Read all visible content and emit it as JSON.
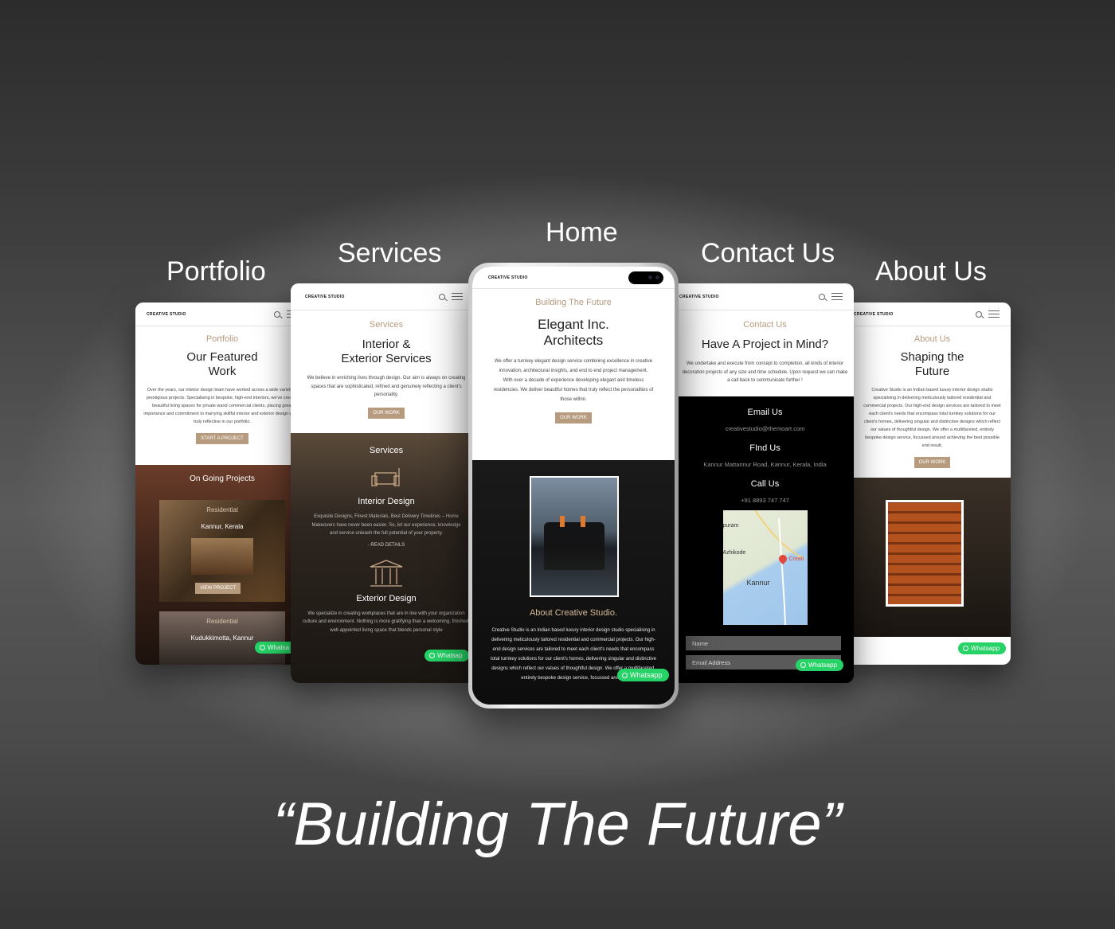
{
  "brand": "CREATIVE STUDIO",
  "tagline": "“Building The Future”",
  "labels": {
    "portfolio": "Portfolio",
    "services": "Services",
    "home": "Home",
    "contact": "Contact Us",
    "about": "About Us"
  },
  "whatsapp_label": "Whatsapp",
  "whatsapp_label_cut": "Whatsa",
  "whatsapp_label_cut2": "Whatsap",
  "colors": {
    "accent": "#b69b7f",
    "whatsapp": "#25d366",
    "dark": "#111111"
  },
  "portfolio": {
    "eyebrow": "Portfolio",
    "heading_1": "Our Featured",
    "heading_2": "Work",
    "body": "Over the years, our interior design team have worked across a wide variety of prestigious projects. Specialising in bespoke, high-end interiors, we've created beautiful living spaces for private wand commercial clients, placing great importance and commitment to marrying skillful interior and exterior design which truly reflective in our portfolio.",
    "button": "START A PROJECT",
    "ongoing_title": "On Going Projects",
    "tag_1": "Residential",
    "location_1": "Kannur, Kerala",
    "view_button": "VIEW PROJECT",
    "tag_2": "Residential",
    "location_2": "Kudukkimotta, Kannur"
  },
  "services": {
    "eyebrow": "Services",
    "heading_1": "Interior &",
    "heading_2": "Exterior Services",
    "body": "We believe in enriching lives through design. Our aim is always on creating spaces that are sophisticated, refined and genuinely reflecting a client's personality.",
    "button": "OUR WORK",
    "dark_title": "Services",
    "interior_title": "Interior Design",
    "interior_body": "Exquisite Designs, Finest Materials, Best Delivery Timelines – Home Makeovers have never been easier. So, let our experience, knowledge and service unleash the full potential of your property.",
    "read_details": "- READ DETAILS",
    "exterior_title": "Exterior Design",
    "exterior_body": "We specialize in creating workplaces that are in line with your organization culture and environment. Nothing is more gratifying than a welcoming, finished, well-appointed living space that blends personal style"
  },
  "home": {
    "eyebrow": "Building The Future",
    "heading_1": "Elegant Inc.",
    "heading_2": "Architects",
    "body_1": "We offer a turnkey elegant design service combining excellence in creative innovation, architectural insights, and end to end project management.",
    "body_2": "With over a decade of experience developing elegant and timeless residencies. We deliver beautiful homes that truly reflect the personalities of those within.",
    "button": "OUR WORK",
    "about_title": "About Creative Studio.",
    "about_body": "Creative Studio is an Indian based luxury interior design studio specialising in delivering meticulously tailored residential and commercial projects. Our high-end design services are tailored to meet each client's needs that encompass total turnkey solutions for our client's homes, delivering singular and distinctive designs which reflect our values of thoughtful design. We offer a multifaceted, entirely bespoke design service, focussed around"
  },
  "contact": {
    "eyebrow": "Contact Us",
    "heading": "Have A Project in Mind?",
    "body": "We undertake and execute from concept to completion, all kinds of interior decoration projects of any size and time schedule. Upon request we can make a call back to communicate further !",
    "email_title": "Email Us",
    "email": "creativestudio@themoart.com",
    "find_title": "FInd Us",
    "address": "Kannur Mattannur Road, Kannur, Kerala, India",
    "call_title": "Call Us",
    "phone": "+91 8893 747 747",
    "map_label_1": "puram",
    "map_label_2": "Azhikode",
    "map_label_3": "Kannur",
    "map_pin_label": "Creati",
    "name_placeholder": "Name",
    "email_placeholder": "Email Address"
  },
  "about": {
    "eyebrow": "About Us",
    "heading_1": "Shaping the",
    "heading_2": "Future",
    "body": "Creative Studio is an Indian based luxury interior design studio specialising in delivering meticulously tailored residential and commercial projects. Our high-end design services are tailored to meet each client's needs that encompass total turnkey solutions for our client's homes, delivering singular and distinctive designs which reflect our values of thoughtful design. We offer a multifaceted, entirely bespoke design service, focussed around achieving the best possible end result.",
    "button": "OUR WORK"
  }
}
